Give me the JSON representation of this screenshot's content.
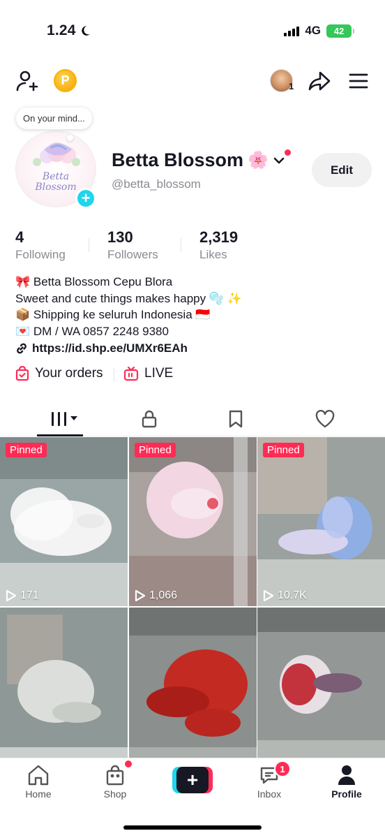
{
  "status": {
    "time": "1.24",
    "network": "4G",
    "battery": "42"
  },
  "bubble": {
    "text": "On your mind..."
  },
  "avatar": {
    "brand_line1": "Betta",
    "brand_line2": "Blossom"
  },
  "profile": {
    "name": "Betta Blossom",
    "name_emoji": "🌸",
    "handle": "@betta_blossom",
    "edit_label": "Edit"
  },
  "friend_notification_count": "1",
  "stats": [
    {
      "value": "4",
      "label": "Following"
    },
    {
      "value": "130",
      "label": "Followers"
    },
    {
      "value": "2,319",
      "label": "Likes"
    }
  ],
  "bio": [
    "🎀 Betta Blossom Cepu Blora",
    "Sweet and cute things makes happy 🫧 ✨",
    "📦 Shipping ke seluruh Indonesia 🇮🇩",
    "💌 DM / WA 0857 2248 9380"
  ],
  "link": "https://id.shp.ee/UMXr6EAh",
  "shortcuts": {
    "orders": "Your orders",
    "live": "LIVE"
  },
  "tabs": [
    "videos-icon",
    "lock-icon",
    "bookmark-icon",
    "heart-icon"
  ],
  "videos": [
    {
      "pinned": "Pinned",
      "views": "171"
    },
    {
      "pinned": "Pinned",
      "views": "1,066"
    },
    {
      "pinned": "Pinned",
      "views": "10.7K"
    },
    {
      "pinned": "",
      "views": ""
    },
    {
      "pinned": "",
      "views": ""
    },
    {
      "pinned": "",
      "views": ""
    }
  ],
  "nav": {
    "home": "Home",
    "shop": "Shop",
    "inbox": "Inbox",
    "inbox_badge": "1",
    "profile": "Profile"
  },
  "colors": {
    "accent": "#fe2c55",
    "cyan": "#20d5ec",
    "text": "#161823",
    "muted": "#8a8b91"
  }
}
